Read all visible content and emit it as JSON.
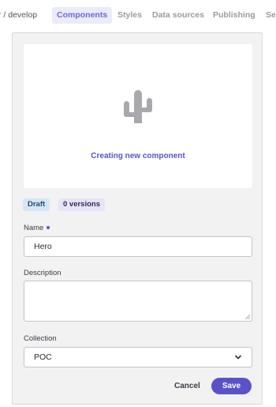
{
  "nav": {
    "breadcrumb": "r / develop",
    "tabs": [
      {
        "label": "Components",
        "active": true
      },
      {
        "label": "Styles"
      },
      {
        "label": "Data sources"
      },
      {
        "label": "Publishing"
      },
      {
        "label": "Set"
      }
    ]
  },
  "preview": {
    "icon": "cactus-icon",
    "caption": "Creating new component"
  },
  "badges": {
    "status": "Draft",
    "versions": "0 versions"
  },
  "form": {
    "name_label": "Name",
    "name_value": "Hero",
    "description_label": "Description",
    "description_value": "",
    "collection_label": "Collection",
    "collection_value": "POC"
  },
  "actions": {
    "cancel": "Cancel",
    "save": "Save"
  },
  "colors": {
    "accent": "#5a52c8",
    "active_tab_bg": "#ecebfb",
    "draft_badge_bg": "#d5e6f6",
    "versions_badge_bg": "#e7e4f8"
  }
}
